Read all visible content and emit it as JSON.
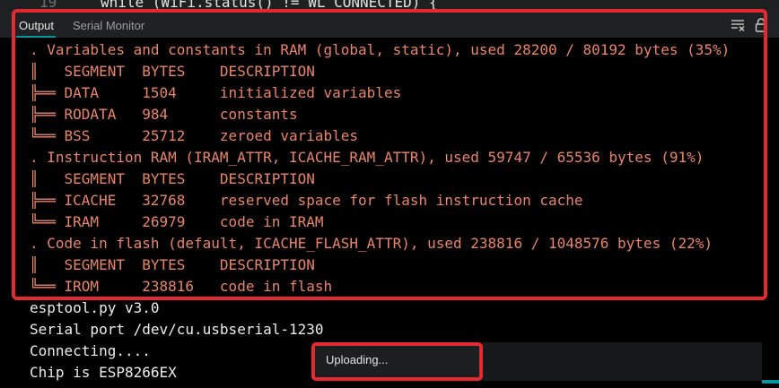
{
  "editor": {
    "line_number": "19",
    "code": "while (WiFi.status() != WL_CONNECTED) {"
  },
  "tabs": {
    "output": "Output",
    "serial": "Serial Monitor"
  },
  "icons": {
    "clear": "clear-output-icon",
    "lock": "lock-icon"
  },
  "colors": {
    "warning_text": "#e6866a",
    "normal_text": "#ececec",
    "highlight": "#e42a31",
    "accent": "#00979d"
  },
  "output_lines": [
    ". Variables and constants in RAM (global, static), used 28200 / 80192 bytes (35%)",
    "║   SEGMENT  BYTES    DESCRIPTION",
    "╠══ DATA     1504     initialized variables",
    "╠══ RODATA   984      constants",
    "╚══ BSS      25712    zeroed variables",
    ". Instruction RAM (IRAM_ATTR, ICACHE_RAM_ATTR), used 59747 / 65536 bytes (91%)",
    "║   SEGMENT  BYTES    DESCRIPTION",
    "╠══ ICACHE   32768    reserved space for flash instruction cache",
    "╚══ IRAM     26979    code in IRAM",
    ". Code in flash (default, ICACHE_FLASH_ATTR), used 238816 / 1048576 bytes (22%)",
    "║   SEGMENT  BYTES    DESCRIPTION",
    "╚══ IROM     238816   code in flash",
    "esptool.py v3.0",
    "Serial port /dev/cu.usbserial-1230",
    "Connecting....",
    "Chip is ESP8266EX"
  ],
  "toast": {
    "message": "Uploading..."
  }
}
